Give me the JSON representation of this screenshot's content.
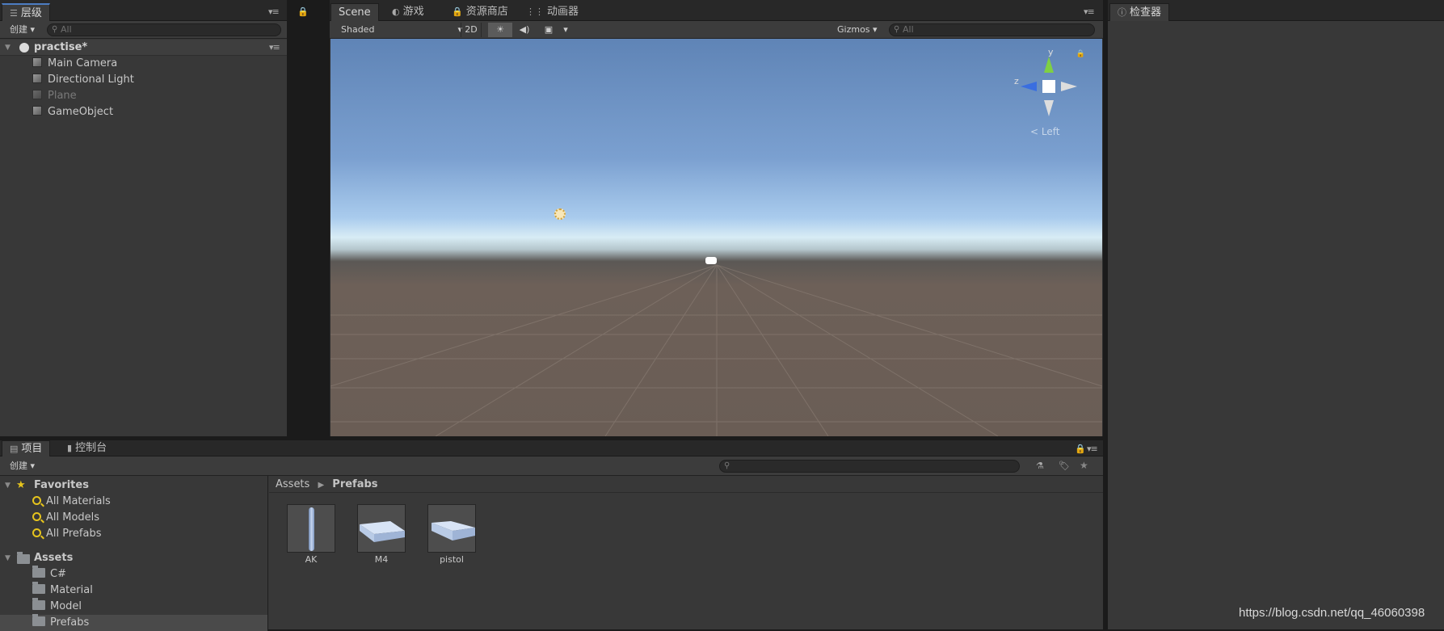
{
  "hierarchy": {
    "tab_label": "层级",
    "create_label": "创建",
    "search_placeholder": "All",
    "scene_name": "practise*",
    "objects": [
      "Main Camera",
      "Directional Light",
      "Plane",
      "GameObject"
    ]
  },
  "scene_view": {
    "tabs": [
      "Scene",
      "游戏",
      "资源商店",
      "动画器"
    ],
    "shading_mode": "Shaded",
    "mode_2d": "2D",
    "gizmos_label": "Gizmos",
    "search_placeholder": "All",
    "gizmo_axes": {
      "y": "y",
      "z": "z"
    },
    "view_label": "Left"
  },
  "inspector": {
    "tab_label": "检查器"
  },
  "project": {
    "tabs": [
      "项目",
      "控制台"
    ],
    "create_label": "创建",
    "favorites_label": "Favorites",
    "favorites": [
      "All Materials",
      "All Models",
      "All Prefabs"
    ],
    "assets_label": "Assets",
    "asset_folders": [
      "C#",
      "Material",
      "Model",
      "Prefabs"
    ],
    "breadcrumb": [
      "Assets",
      "Prefabs"
    ],
    "items": [
      "AK",
      "M4",
      "pistol"
    ]
  },
  "watermark": "https://blog.csdn.net/qq_46060398"
}
